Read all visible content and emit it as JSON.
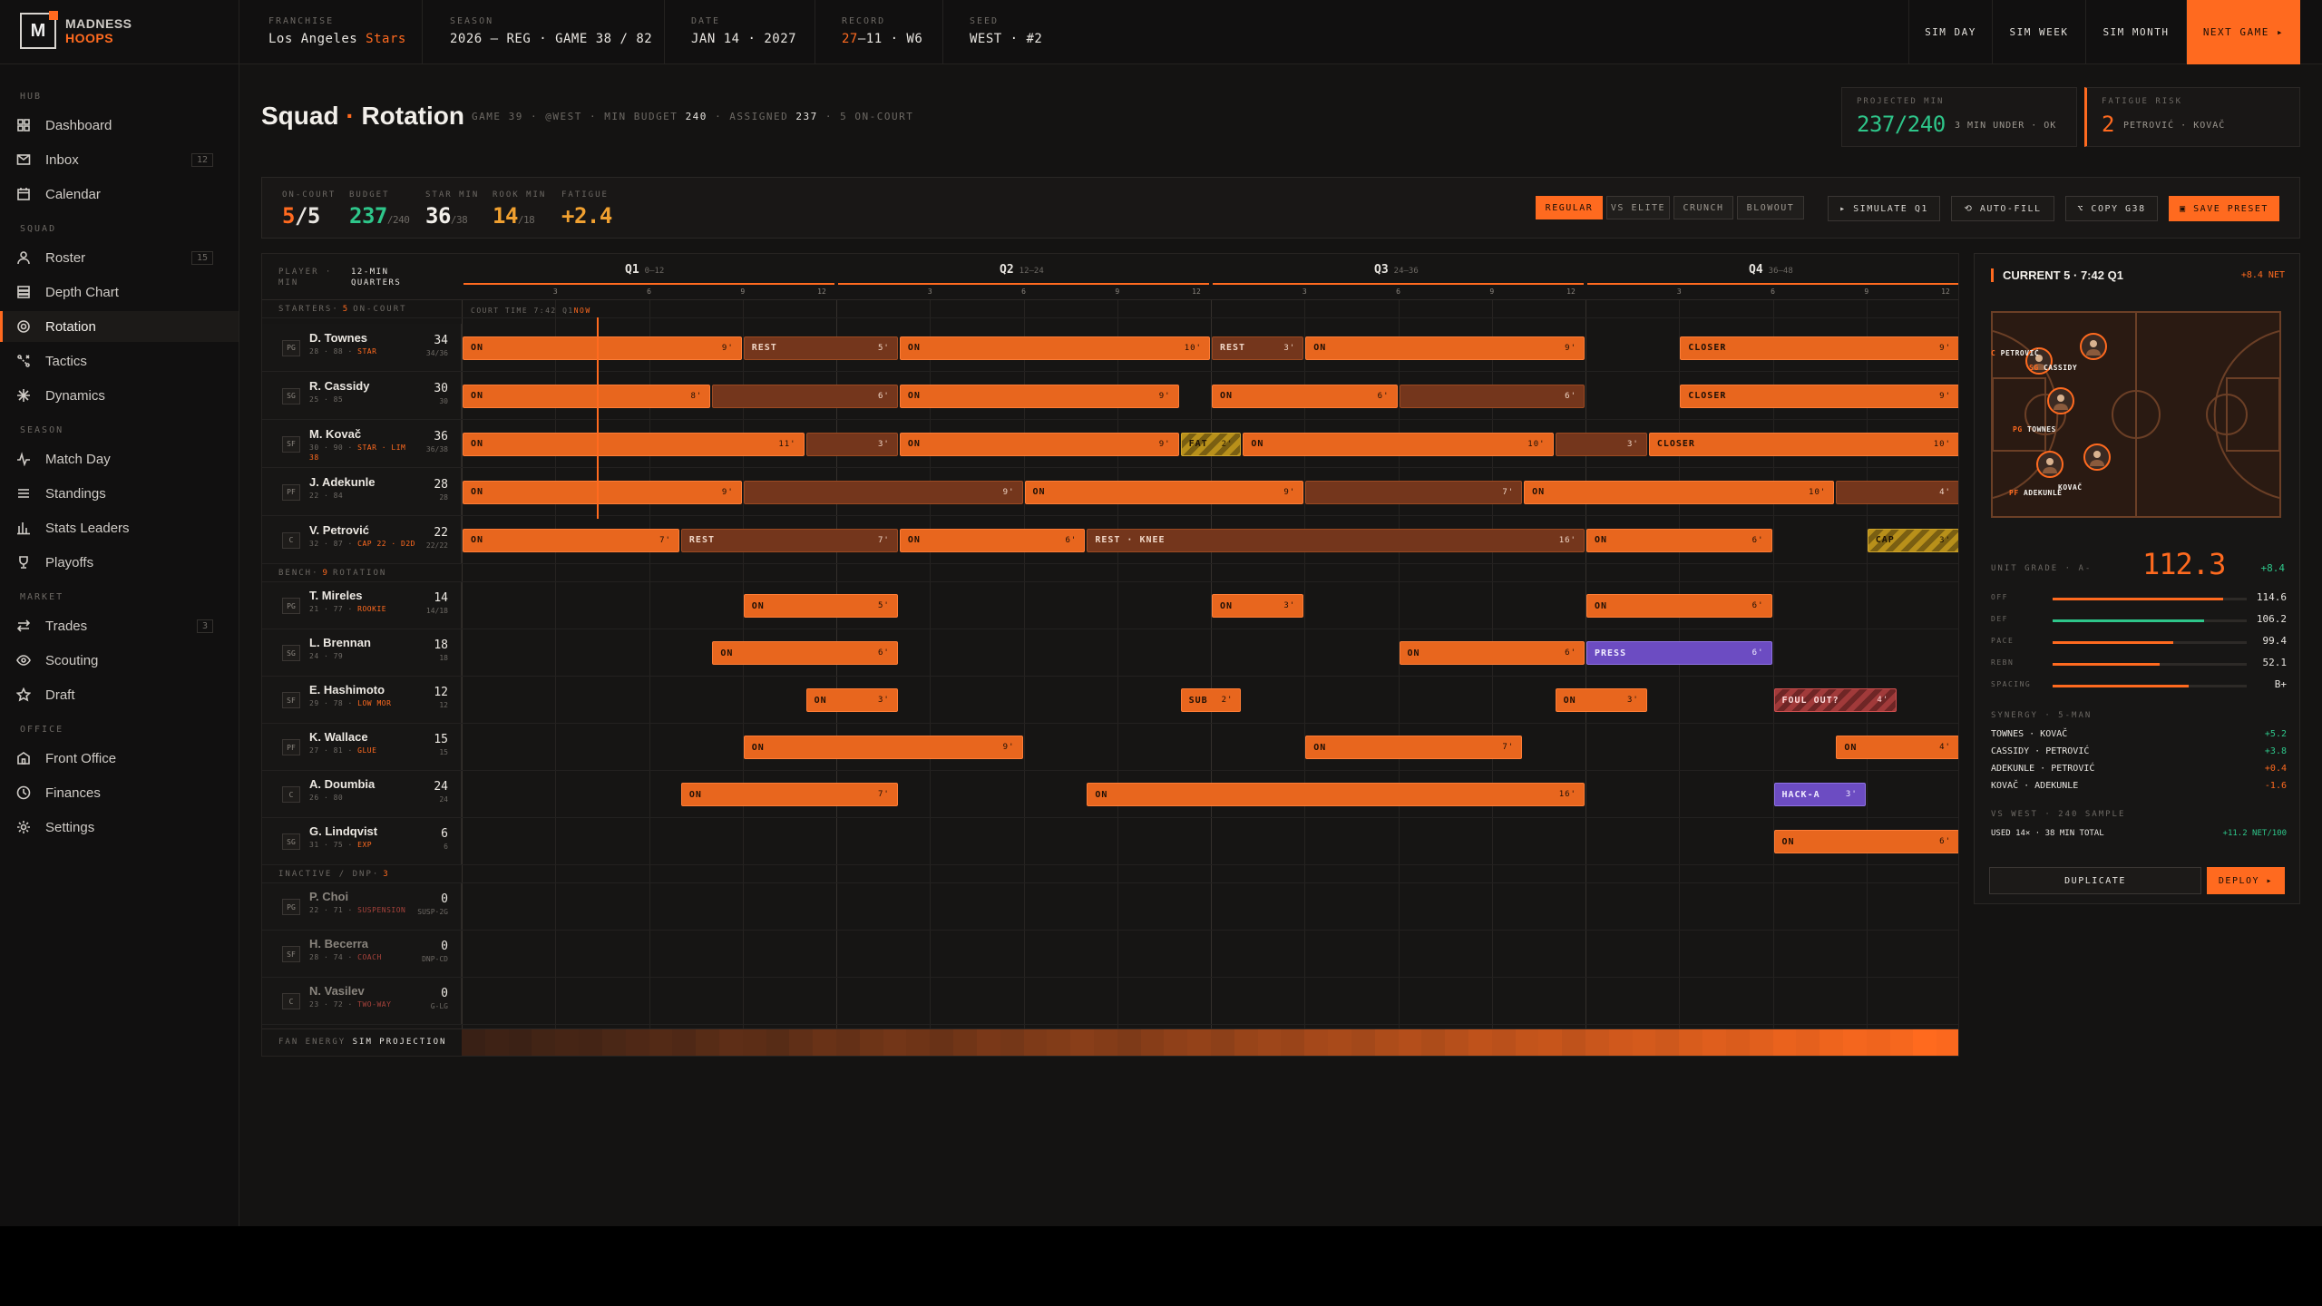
{
  "app": {
    "logo_line1": "MADNESS",
    "logo_line2": "HOOPS",
    "logo_mark": "M",
    "accent": "#ff6a1f"
  },
  "topbar": {
    "franchise_label": "FRANCHISE",
    "franchise_city": "Los Angeles",
    "franchise_team": "Stars",
    "season_label": "SEASON",
    "season_value": "2026 — REG · GAME 38 / 82",
    "date_label": "DATE",
    "date_value": "JAN 14 · 2027",
    "record_label": "RECORD",
    "record_wins": "27",
    "record_rest": "–11 · W6",
    "seed_label": "SEED",
    "seed_value": "WEST · #2",
    "buttons": [
      "SIM DAY",
      "SIM WEEK",
      "SIM MONTH",
      "NEXT GAME ▸"
    ]
  },
  "sidebar": {
    "sections": [
      {
        "title": "HUB",
        "items": [
          {
            "label": "Dashboard",
            "icon": "grid-icon"
          },
          {
            "label": "Inbox",
            "icon": "mail-icon",
            "badge": "12"
          },
          {
            "label": "Calendar",
            "icon": "calendar-icon"
          }
        ]
      },
      {
        "title": "SQUAD",
        "items": [
          {
            "label": "Roster",
            "icon": "user-icon",
            "badge": "15"
          },
          {
            "label": "Depth Chart",
            "icon": "layers-icon"
          },
          {
            "label": "Rotation",
            "icon": "target-icon",
            "active": true
          },
          {
            "label": "Tactics",
            "icon": "tactics-icon"
          },
          {
            "label": "Dynamics",
            "icon": "spark-icon"
          }
        ]
      },
      {
        "title": "SEASON",
        "items": [
          {
            "label": "Match Day",
            "icon": "pulse-icon"
          },
          {
            "label": "Standings",
            "icon": "list-icon"
          },
          {
            "label": "Stats Leaders",
            "icon": "bars-icon"
          },
          {
            "label": "Playoffs",
            "icon": "trophy-icon"
          }
        ]
      },
      {
        "title": "MARKET",
        "items": [
          {
            "label": "Trades",
            "icon": "swap-icon",
            "badge": "3"
          },
          {
            "label": "Scouting",
            "icon": "eye-icon"
          },
          {
            "label": "Draft",
            "icon": "star-icon"
          }
        ]
      },
      {
        "title": "OFFICE",
        "items": [
          {
            "label": "Front Office",
            "icon": "building-icon"
          },
          {
            "label": "Finances",
            "icon": "clock-icon"
          },
          {
            "label": "Settings",
            "icon": "gear-icon"
          }
        ]
      }
    ]
  },
  "header": {
    "title_a": "Squad",
    "title_sep": "·",
    "title_b": "Rotation",
    "sub_a": "GAME 39 · @WEST · MIN BUDGET",
    "budget": "240",
    "sub_b": "· ASSIGNED",
    "assigned": "237",
    "sub_c": "· 5 ON-COURT",
    "proj_label": "PROJECTED MIN",
    "proj_value": "237/240",
    "proj_note": "3 MIN UNDER · OK",
    "fat_label": "FATIGUE RISK",
    "fat_value": "2",
    "fat_note": "PETROVIĆ · KOVAČ"
  },
  "strip": {
    "oncourt_label": "ON-COURT",
    "oncourt_a": "5",
    "oncourt_b": "/5",
    "budget_label": "BUDGET",
    "budget_a": "237",
    "budget_b": "/240",
    "star_label": "STAR MIN",
    "star_a": "36",
    "star_b": "/38",
    "rook_label": "ROOK MIN",
    "rook_a": "14",
    "rook_b": "/18",
    "fatigue_label": "FATIGUE",
    "fatigue_value": "+2.4",
    "modes": [
      "REGULAR",
      "VS ELITE",
      "CRUNCH",
      "BLOWOUT"
    ],
    "actions": [
      "▸ SIMULATE Q1",
      "⟲ AUTO-FILL",
      "⌥ COPY G38",
      "▣ SAVE PRESET"
    ]
  },
  "timeline": {
    "player_min_label": "PLAYER · MIN",
    "quarters_label": "12-MIN QUARTERS",
    "quarters": [
      {
        "label": "Q1",
        "range": "0–12"
      },
      {
        "label": "Q2",
        "range": "12–24"
      },
      {
        "label": "Q3",
        "range": "24–36"
      },
      {
        "label": "Q4",
        "range": "36–48"
      }
    ],
    "ticks": [
      "3",
      "6",
      "9",
      "12"
    ],
    "starters_label": "STARTERS",
    "starters_count": "5",
    "starters_suffix": "ON-COURT",
    "court_time": "COURT TIME 7:42 Q1",
    "now_label": "NOW",
    "bench_label": "BENCH",
    "bench_count": "9",
    "bench_suffix": "ROTATION",
    "inactive_label": "INACTIVE / DNP",
    "inactive_count": "3",
    "energy_label": "FAN ENERGY",
    "energy_projection": "SIM PROJECTION",
    "energy_levels": [
      0.08,
      0.1,
      0.09,
      0.12,
      0.14,
      0.13,
      0.16,
      0.18,
      0.2,
      0.18,
      0.22,
      0.25,
      0.24,
      0.22,
      0.26,
      0.3,
      0.28,
      0.32,
      0.35,
      0.33,
      0.3,
      0.34,
      0.38,
      0.36,
      0.4,
      0.42,
      0.45,
      0.43,
      0.4,
      0.44,
      0.48,
      0.5,
      0.47,
      0.52,
      0.55,
      0.53,
      0.58,
      0.6,
      0.57,
      0.62,
      0.65,
      0.62,
      0.66,
      0.7,
      0.68,
      0.72,
      0.74,
      0.7,
      0.75,
      0.78,
      0.8,
      0.77,
      0.82,
      0.85,
      0.83,
      0.86,
      0.9,
      0.88,
      0.92,
      0.95,
      0.93,
      0.96,
      1.0,
      0.98
    ]
  },
  "players": {
    "starters": [
      {
        "pos": "PG",
        "name": "D. Townes",
        "meta": "28 · 88",
        "tag": "STAR",
        "min": "34",
        "sub": "34/36",
        "bars": [
          [
            0,
            9,
            "on",
            "ON",
            "9'"
          ],
          [
            9,
            14,
            "rest",
            "REST",
            "5'"
          ],
          [
            14,
            24,
            "on",
            "ON",
            "10'"
          ],
          [
            24,
            27,
            "rest",
            "REST",
            "3'"
          ],
          [
            27,
            36,
            "on",
            "ON",
            "9'"
          ],
          [
            39,
            48,
            "on",
            "CLOSER",
            "9'"
          ]
        ]
      },
      {
        "pos": "SG",
        "name": "R. Cassidy",
        "meta": "25 · 85",
        "tag": "",
        "min": "30",
        "sub": "30",
        "bars": [
          [
            0,
            8,
            "on",
            "ON",
            "8'"
          ],
          [
            8,
            14,
            "rest",
            "",
            "6'"
          ],
          [
            14,
            23,
            "on",
            "ON",
            "9'"
          ],
          [
            24,
            30,
            "on",
            "ON",
            "6'"
          ],
          [
            30,
            36,
            "rest",
            "",
            "6'"
          ],
          [
            39,
            48,
            "on",
            "CLOSER",
            "9'"
          ]
        ]
      },
      {
        "pos": "SF",
        "name": "M. Kovač",
        "meta": "30 · 90",
        "tag": "STAR · LIM 38",
        "min": "36",
        "sub": "36/38",
        "bars": [
          [
            0,
            11,
            "on",
            "ON",
            "11'"
          ],
          [
            11,
            14,
            "rest",
            "",
            "3'"
          ],
          [
            14,
            23,
            "on",
            "ON",
            "9'"
          ],
          [
            23,
            25,
            "fat",
            "FAT",
            "2'"
          ],
          [
            25,
            35,
            "on",
            "ON",
            "10'"
          ],
          [
            35,
            38,
            "rest",
            "",
            "3'"
          ],
          [
            38,
            48,
            "on",
            "CLOSER",
            "10'"
          ]
        ]
      },
      {
        "pos": "PF",
        "name": "J. Adekunle",
        "meta": "22 · 84",
        "tag": "",
        "min": "28",
        "sub": "28",
        "bars": [
          [
            0,
            9,
            "on",
            "ON",
            "9'"
          ],
          [
            9,
            18,
            "rest",
            "",
            "9'"
          ],
          [
            18,
            27,
            "on",
            "ON",
            "9'"
          ],
          [
            27,
            34,
            "rest",
            "",
            "7'"
          ],
          [
            34,
            44,
            "on",
            "ON",
            "10'"
          ],
          [
            44,
            48,
            "rest",
            "",
            "4'"
          ]
        ]
      },
      {
        "pos": "C",
        "name": "V. Petrović",
        "meta": "32 · 87",
        "tag": "CAP 22 · D2D",
        "min": "22",
        "sub": "22/22",
        "bars": [
          [
            0,
            7,
            "on",
            "ON",
            "7'"
          ],
          [
            7,
            14,
            "rest",
            "REST",
            "7'"
          ],
          [
            14,
            20,
            "on",
            "ON",
            "6'"
          ],
          [
            20,
            36,
            "rest",
            "REST · KNEE",
            "16'"
          ],
          [
            36,
            42,
            "on",
            "ON",
            "6'"
          ],
          [
            45,
            48,
            "fat",
            "CAP",
            "3'"
          ]
        ]
      }
    ],
    "bench": [
      {
        "pos": "PG",
        "name": "T. Mireles",
        "meta": "21 · 77",
        "tag": "ROOKIE",
        "min": "14",
        "sub": "14/18",
        "bars": [
          [
            9,
            14,
            "on",
            "ON",
            "5'"
          ],
          [
            24,
            27,
            "on",
            "ON",
            "3'"
          ],
          [
            36,
            42,
            "on",
            "ON",
            "6'"
          ]
        ]
      },
      {
        "pos": "SG",
        "name": "L. Brennan",
        "meta": "24 · 79",
        "tag": "",
        "min": "18",
        "sub": "18",
        "bars": [
          [
            8,
            14,
            "on",
            "ON",
            "6'"
          ],
          [
            30,
            36,
            "on",
            "ON",
            "6'"
          ],
          [
            36,
            42,
            "press",
            "PRESS",
            "6'"
          ]
        ]
      },
      {
        "pos": "SF",
        "name": "E. Hashimoto",
        "meta": "29 · 78",
        "tag": "LOW MOR",
        "min": "12",
        "sub": "12",
        "bars": [
          [
            11,
            14,
            "on",
            "ON",
            "3'"
          ],
          [
            23,
            25,
            "on",
            "SUB",
            "2'"
          ],
          [
            35,
            38,
            "on",
            "ON",
            "3'"
          ],
          [
            42,
            46,
            "foul",
            "FOUL OUT?",
            "4'"
          ]
        ]
      },
      {
        "pos": "PF",
        "name": "K. Wallace",
        "meta": "27 · 81",
        "tag": "GLUE",
        "min": "15",
        "sub": "15",
        "bars": [
          [
            9,
            18,
            "on",
            "ON",
            "9'"
          ],
          [
            27,
            34,
            "on",
            "ON",
            "7'"
          ],
          [
            44,
            48,
            "on",
            "ON",
            "4'"
          ]
        ]
      },
      {
        "pos": "C",
        "name": "A. Doumbia",
        "meta": "26 · 80",
        "tag": "",
        "min": "24",
        "sub": "24",
        "bars": [
          [
            7,
            14,
            "on",
            "ON",
            "7'"
          ],
          [
            20,
            36,
            "on",
            "ON",
            "16'"
          ],
          [
            42,
            45,
            "press",
            "HACK-A",
            "3'"
          ]
        ]
      },
      {
        "pos": "SG",
        "name": "G. Lindqvist",
        "meta": "31 · 75",
        "tag": "EXP",
        "min": "6",
        "sub": "6",
        "bars": [
          [
            42,
            48,
            "on",
            "ON",
            "6'"
          ]
        ]
      }
    ],
    "inactive": [
      {
        "pos": "PG",
        "name": "P. Choi",
        "meta": "22 · 71",
        "tag": "SUSPENSION",
        "min": "0",
        "sub": "SUSP·2G"
      },
      {
        "pos": "SF",
        "name": "H. Becerra",
        "meta": "28 · 74",
        "tag": "COACH",
        "min": "0",
        "sub": "DNP-CD"
      },
      {
        "pos": "C",
        "name": "N. Vasilev",
        "meta": "23 · 72",
        "tag": "TWO-WAY",
        "min": "0",
        "sub": "G-LG"
      }
    ]
  },
  "panel": {
    "title": "CURRENT 5 · 7:42 Q1",
    "net": "+8.4 NET",
    "court": [
      {
        "pos": "C",
        "name": "PETROVIĆ"
      },
      {
        "pos": "SG",
        "name": "CASSIDY"
      },
      {
        "pos": "PG",
        "name": "TOWNES"
      },
      {
        "pos": "PF",
        "name": "ADEKUNLE"
      },
      {
        "pos": "",
        "name": "KOVAČ"
      }
    ],
    "grade_label": "UNIT GRADE · A-",
    "grade_value": "112.3",
    "grade_delta": "+8.4",
    "metrics": [
      {
        "label": "OFF",
        "value": "114.6",
        "fill": 0.88,
        "color": "#ff6a1f"
      },
      {
        "label": "DEF",
        "value": "106.2",
        "fill": 0.78,
        "color": "#2ec68a"
      },
      {
        "label": "PACE",
        "value": "99.4",
        "fill": 0.62,
        "color": "#ff6a1f"
      },
      {
        "label": "REBN",
        "value": "52.1",
        "fill": 0.55,
        "color": "#ff6a1f"
      },
      {
        "label": "SPACING",
        "value": "B+",
        "fill": 0.7,
        "color": "#ff6a1f"
      }
    ],
    "synergy_label": "SYNERGY · 5-MAN",
    "synergy": [
      {
        "pair": "TOWNES · KOVAČ",
        "value": "+5.2",
        "dir": "up"
      },
      {
        "pair": "CASSIDY · PETROVIĆ",
        "value": "+3.8",
        "dir": "up"
      },
      {
        "pair": "ADEKUNLE · PETROVIĆ",
        "value": "+0.4",
        "dir": "dn"
      },
      {
        "pair": "KOVAČ · ADEKUNLE",
        "value": "-1.6",
        "dir": "dn"
      }
    ],
    "vs_label": "VS WEST · 240 SAMPLE",
    "vs_left": "USED 14× · 38 MIN TOTAL",
    "vs_right": "+11.2 NET/100",
    "btn_dup": "DUPLICATE",
    "btn_deploy": "DEPLOY ▸"
  }
}
